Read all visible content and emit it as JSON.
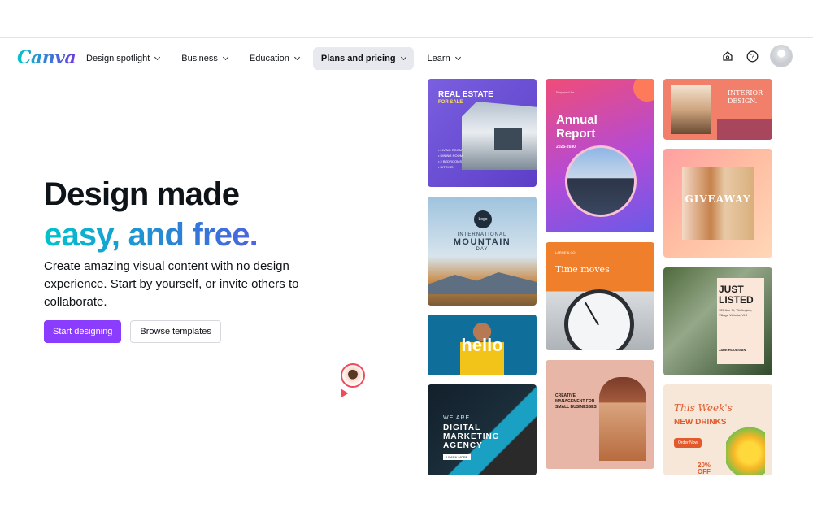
{
  "nav": {
    "logo": "Canva",
    "menu": [
      {
        "label": "Design spotlight"
      },
      {
        "label": "Business"
      },
      {
        "label": "Education"
      },
      {
        "label": "Plans and pricing"
      },
      {
        "label": "Learn"
      }
    ],
    "icons": [
      "home-icon",
      "help-icon"
    ]
  },
  "hero": {
    "title_line1": "Design made",
    "title_line2": "easy, and free.",
    "subtitle": "Create amazing visual content with no design experience. Start by yourself, or invite others to collaborate.",
    "primary_button": "Start designing",
    "secondary_button": "Browse templates"
  },
  "templates": {
    "realestate": {
      "title": "REAL ESTATE",
      "subtitle": "FOR SALE",
      "features": [
        "• LIVING ROOM",
        "• DINING ROOM",
        "• 2 BEDROOMS",
        "• KITCHEN"
      ]
    },
    "mountain": {
      "badge": "Logo",
      "line1": "INTERNATIONAL",
      "line2": "MOUNTAIN",
      "line3": "DAY"
    },
    "hello": {
      "text": "hello"
    },
    "digital": {
      "line1": "WE ARE",
      "line2": "DIGITAL",
      "line3": "MARKETING",
      "line4": "AGENCY",
      "cta": "LEARN MORE"
    },
    "annual": {
      "small": "Prepared for",
      "title1": "Annual",
      "title2": "Report",
      "years": "2025-2030"
    },
    "time": {
      "brand": "LARGE & CO",
      "title": "Time moves"
    },
    "creative": {
      "text": "CREATIVE MANAGEMENT FOR SMALL BUSINESSES"
    },
    "interior": {
      "line1": "INTERIOR",
      "line2": "DESIGN."
    },
    "giveaway": {
      "text": "GIVEAWAY"
    },
    "listed": {
      "line1": "JUST",
      "line2": "LISTED",
      "address": "125 Ave St, Wellington, Village Victoria, VIC",
      "agent": "JADE HOOLIGAN"
    },
    "drinks": {
      "line1": "This Week's",
      "line2": "NEW DRINKS",
      "cta": "Order Now",
      "promo1": "20%",
      "promo2": "OFF"
    }
  },
  "colors": {
    "accent": "#8b3dff",
    "nav_active_bg": "#e8e9ee",
    "gradient_start": "#00c4cc",
    "gradient_end": "#7b3ff2"
  }
}
